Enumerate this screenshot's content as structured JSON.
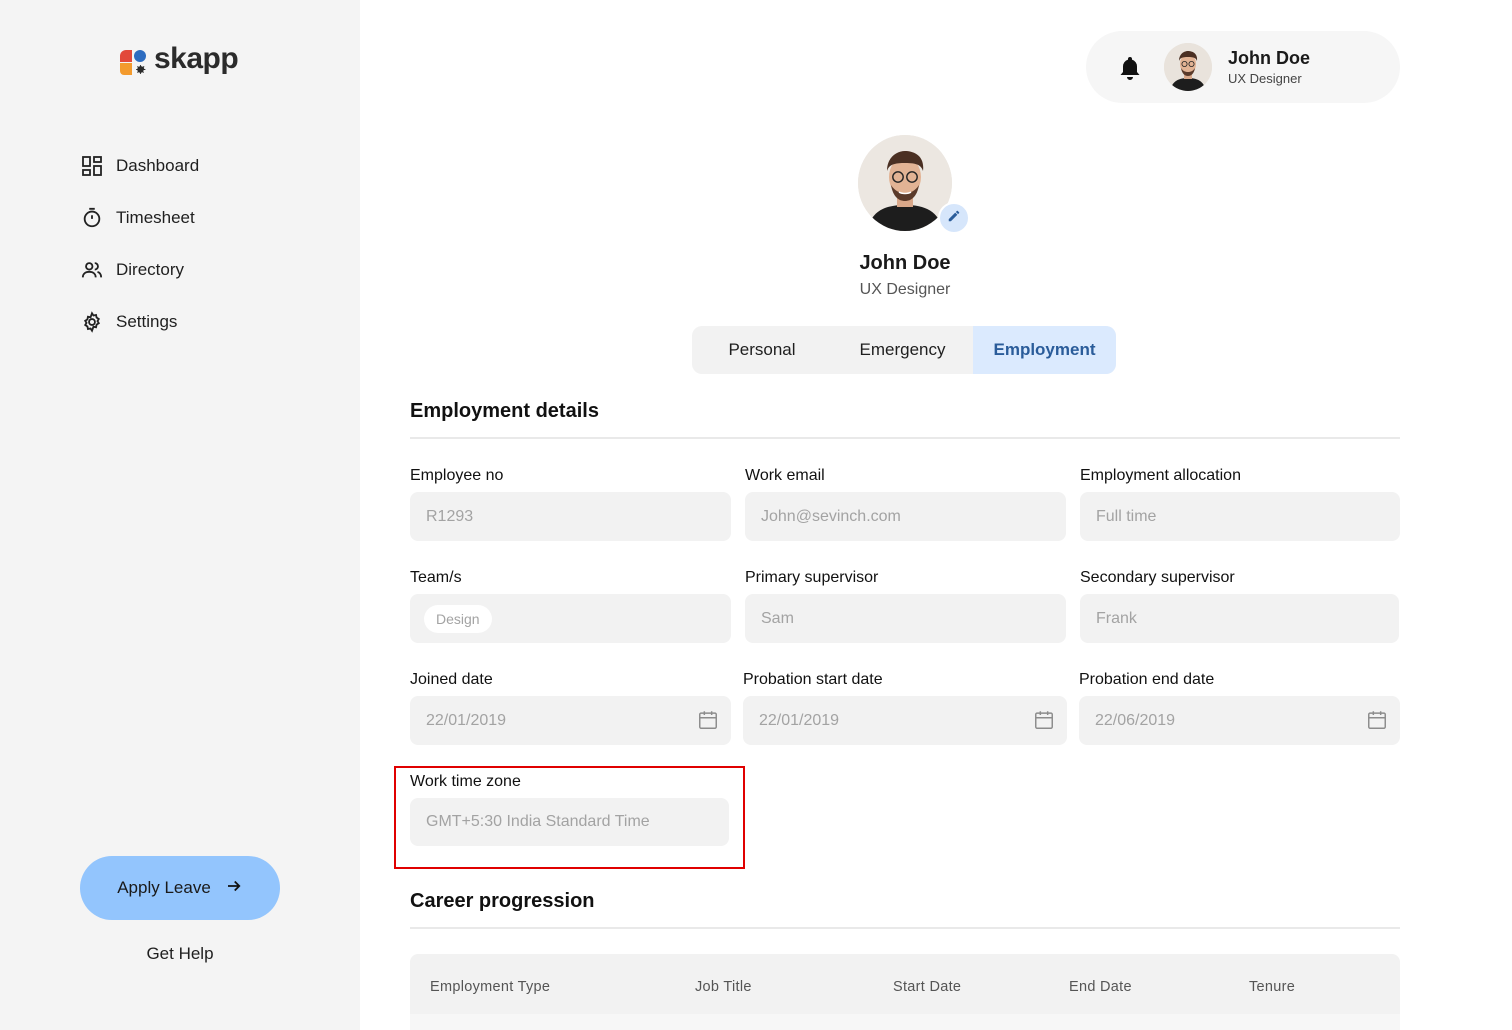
{
  "app": {
    "name": "skapp"
  },
  "sidebar": {
    "items": [
      {
        "label": "Dashboard",
        "icon": "dashboard-icon"
      },
      {
        "label": "Timesheet",
        "icon": "stopwatch-icon"
      },
      {
        "label": "Directory",
        "icon": "people-icon"
      },
      {
        "label": "Settings",
        "icon": "gear-icon"
      }
    ],
    "apply_leave": "Apply Leave",
    "get_help": "Get Help"
  },
  "user": {
    "name": "John Doe",
    "role": "UX Designer"
  },
  "profile": {
    "name": "John Doe",
    "role": "UX Designer"
  },
  "tabs": [
    {
      "label": "Personal",
      "active": false
    },
    {
      "label": "Emergency",
      "active": false
    },
    {
      "label": "Employment",
      "active": true
    }
  ],
  "employment": {
    "title": "Employment  details",
    "fields": {
      "employee_no": {
        "label": "Employee no",
        "value": "R1293"
      },
      "work_email": {
        "label": "Work email",
        "value": "John@sevinch.com"
      },
      "allocation": {
        "label": "Employment allocation",
        "value": "Full time"
      },
      "teams": {
        "label": "Team/s",
        "value": "Design"
      },
      "primary_supervisor": {
        "label": "Primary supervisor",
        "value": "Sam"
      },
      "secondary_supervisor": {
        "label": "Secondary supervisor",
        "value": "Frank"
      },
      "joined_date": {
        "label": "Joined date",
        "value": "22/01/2019"
      },
      "probation_start": {
        "label": "Probation start date",
        "value": "22/01/2019"
      },
      "probation_end": {
        "label": "Probation end date",
        "value": "22/06/2019"
      },
      "time_zone": {
        "label": "Work time zone",
        "value": "GMT+5:30 India Standard Time"
      }
    }
  },
  "career": {
    "title": "Career progression",
    "columns": [
      "Employment Type",
      "Job Title",
      "Start Date",
      "End Date",
      "Tenure"
    ]
  },
  "colors": {
    "accent": "#93c5fd",
    "active_tab_bg": "#dbeafe",
    "active_tab_text": "#2a5c9a",
    "highlight": "#e00000"
  }
}
